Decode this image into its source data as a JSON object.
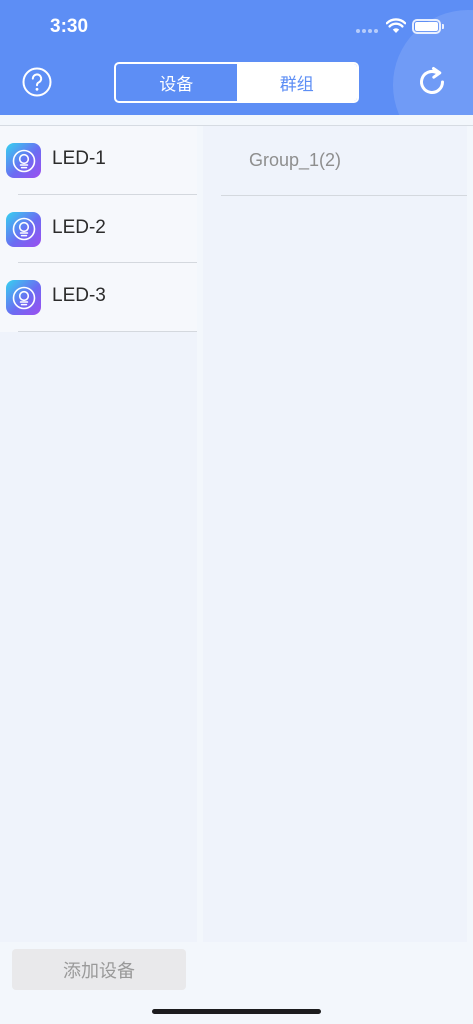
{
  "status_bar": {
    "time": "3:30"
  },
  "header": {
    "help_icon": "help-circle-icon",
    "refresh_icon": "refresh-icon",
    "tabs": [
      {
        "label": "设备",
        "active": false
      },
      {
        "label": "群组",
        "active": true
      }
    ]
  },
  "devices": {
    "items": [
      {
        "label": "LED-1",
        "icon": "led-device-icon"
      },
      {
        "label": "LED-2",
        "icon": "led-device-icon"
      },
      {
        "label": "LED-3",
        "icon": "led-device-icon"
      }
    ]
  },
  "groups": {
    "items": [
      {
        "label": "Group_1(2)"
      }
    ]
  },
  "footer": {
    "add_device_label": "添加设备"
  },
  "colors": {
    "header_blue": "#5d8ef5",
    "panel_bg": "#eff3fb",
    "text_dark": "#2c2c2c",
    "text_muted": "#8e8e8e"
  }
}
